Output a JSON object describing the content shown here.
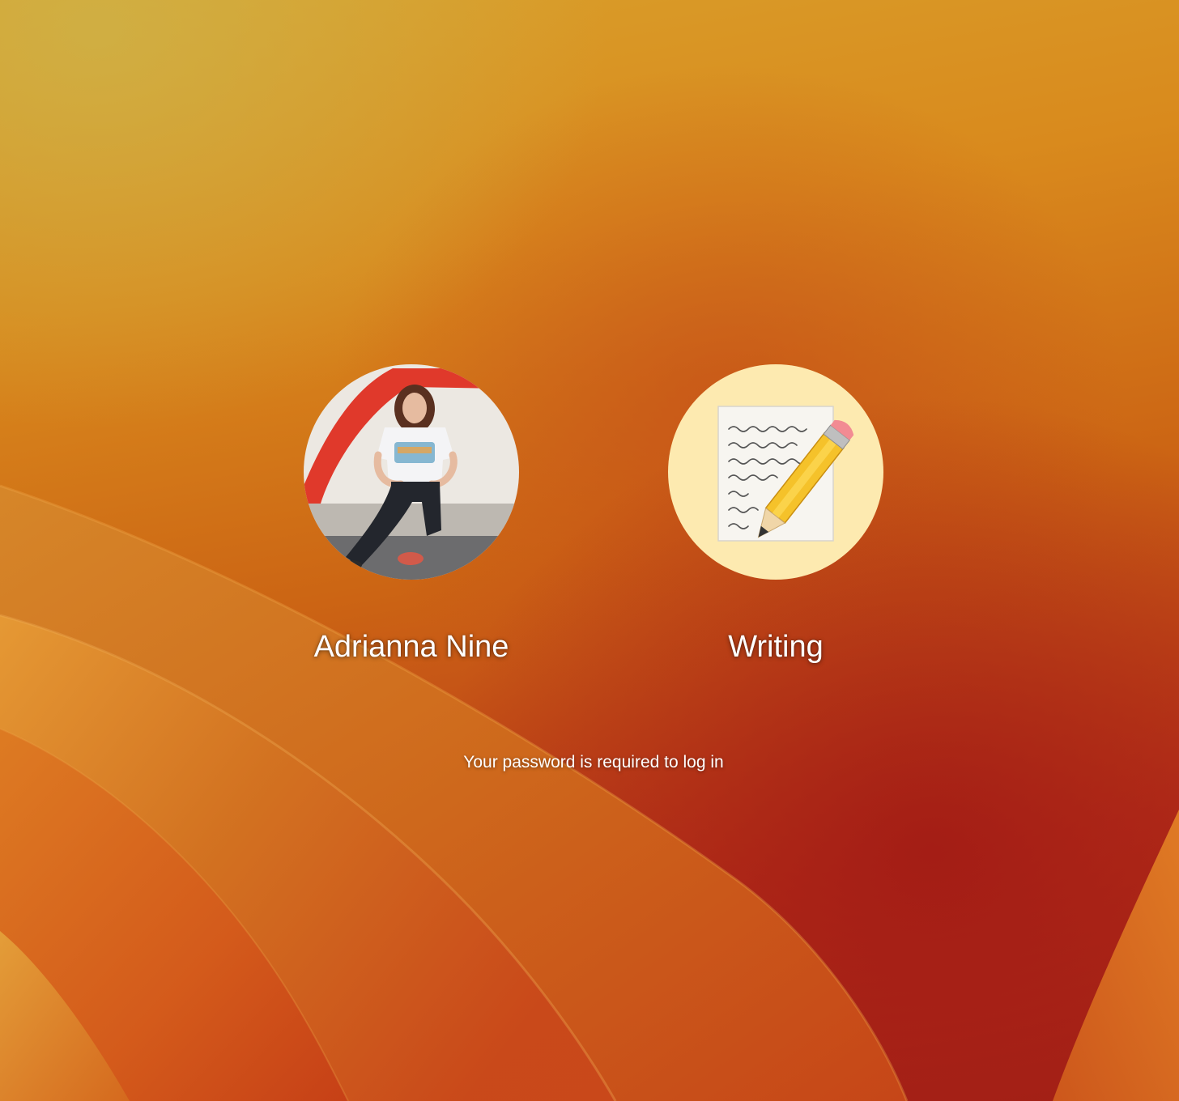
{
  "users": [
    {
      "name": "Adrianna Nine",
      "avatar_icon": "user-photo-avatar"
    },
    {
      "name": "Writing",
      "avatar_icon": "notepad-pencil-icon"
    }
  ],
  "prompt": {
    "text": "Your password is required to log in"
  },
  "colors": {
    "text": "#ffffff",
    "writing_avatar_bg": "#fdeab0"
  }
}
